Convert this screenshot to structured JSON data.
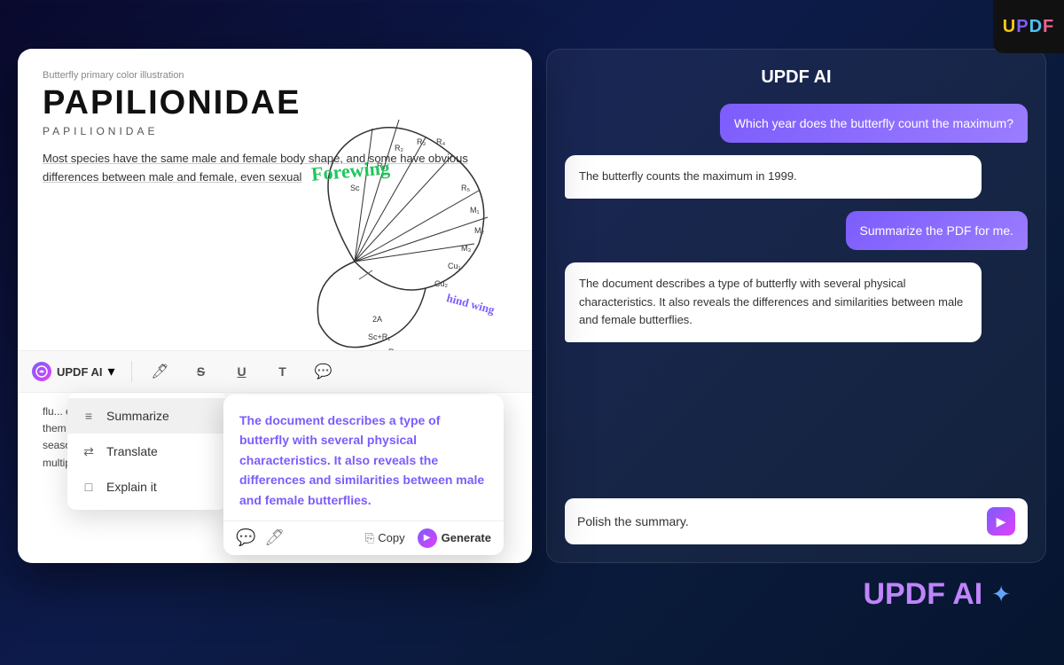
{
  "logo": {
    "letters": {
      "u": "U",
      "p": "P",
      "d": "D",
      "f": "F"
    }
  },
  "pdf": {
    "subtitle": "Butterfly primary color illustration",
    "title": "PAPILIONIDAE",
    "title_small": "PAPILIONIDAE",
    "body_text": "Most species have the same male and female body shape, and some have obvious differences between male and female, even sexual",
    "lower_text": "flu... edge folds of hindwings, and them show differences due to seasons, and some species h... multiple types of females.",
    "forewing_label": "Forewing",
    "hindwing_label": "hind wing"
  },
  "toolbar": {
    "ai_label": "UPDF AI",
    "chevron": "▾"
  },
  "dropdown": {
    "items": [
      {
        "id": "summarize",
        "label": "Summarize",
        "icon": "≡"
      },
      {
        "id": "translate",
        "label": "Translate",
        "icon": "⇄"
      },
      {
        "id": "explain",
        "label": "Explain it",
        "icon": "□"
      }
    ]
  },
  "summarize_result": {
    "text": "The document describes a type of butterfly with several physical characteristics. It also reveals the differences and similarities between male and female butterflies."
  },
  "bottom_bar": {
    "copy_label": "Copy",
    "generate_label": "Generate"
  },
  "ai_panel": {
    "title": "UPDF AI",
    "messages": [
      {
        "type": "user",
        "text": "Which year does the butterfly count the maximum?"
      },
      {
        "type": "ai",
        "text": "The butterfly counts the maximum in 1999."
      },
      {
        "type": "user",
        "text": "Summarize the PDF for me."
      },
      {
        "type": "ai",
        "text": "The document describes a type of butterfly with several physical characteristics. It also reveals the differences and similarities between male and female butterflies."
      }
    ],
    "input_placeholder": "Polish the summary.",
    "input_value": "Polish the summary."
  },
  "brand": {
    "text": "UPDF AI"
  }
}
